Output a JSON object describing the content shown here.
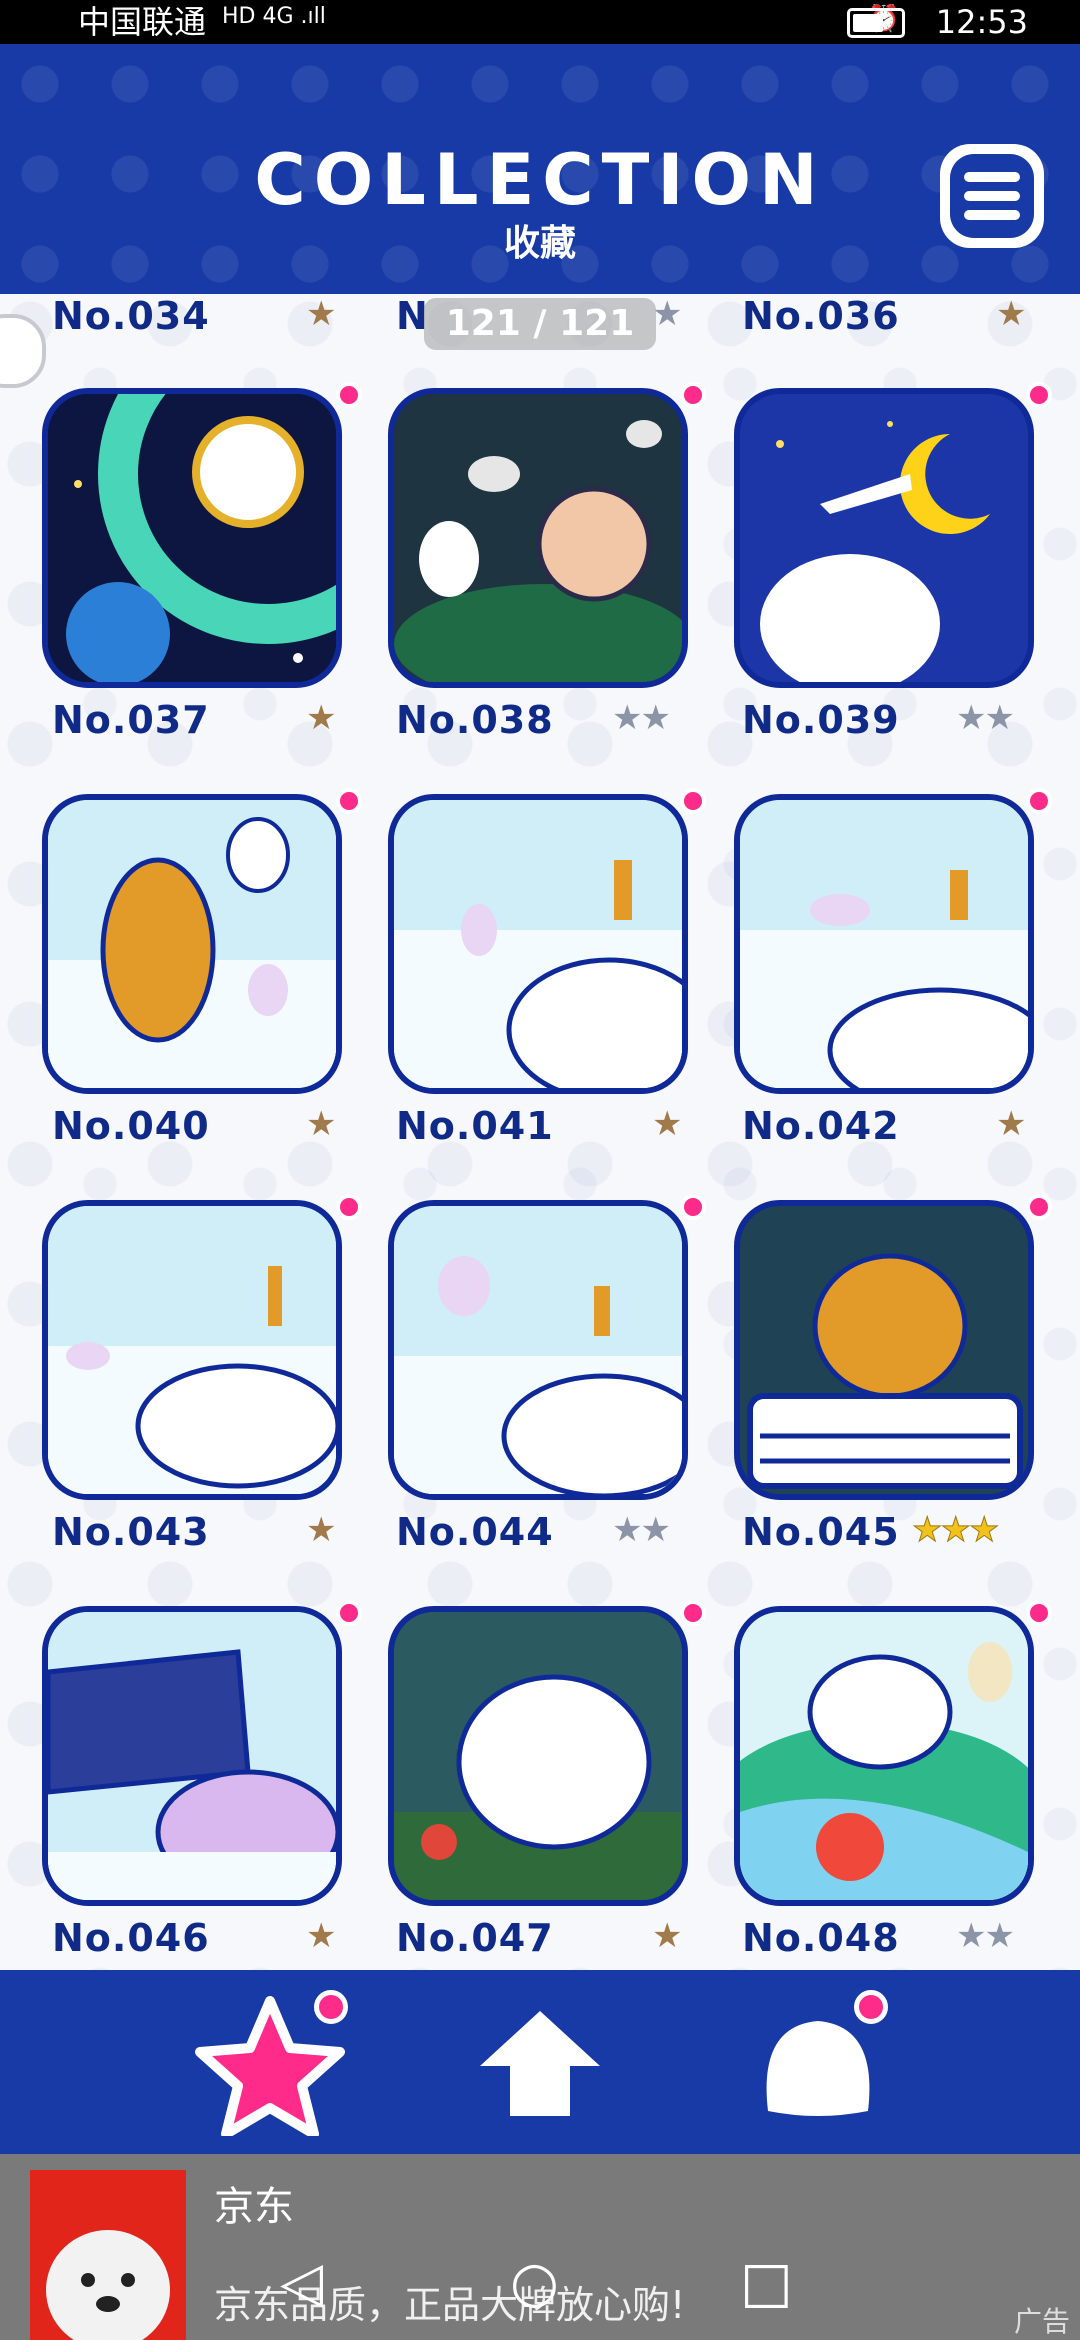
{
  "status_bar": {
    "carrier": "中国联通",
    "indicators": "HD 4G .ıll",
    "time": "12:53"
  },
  "header": {
    "title": "COLLECTION",
    "subtitle": "收藏",
    "menu_icon": "hamburger-menu-icon"
  },
  "counter": "121 / 121",
  "partial_row": [
    {
      "number": "No.034",
      "stars": 1,
      "star_color": "bronze"
    },
    {
      "number": "N",
      "stars": 1,
      "star_color": "grey"
    },
    {
      "number": "No.036",
      "stars": 1,
      "star_color": "bronze"
    }
  ],
  "items": [
    {
      "number": "No.037",
      "stars": "★",
      "star_color": "bronze",
      "scene": "space-dog-planet"
    },
    {
      "number": "No.038",
      "stars": "★★",
      "star_color": "grey",
      "scene": "night-bush-dog"
    },
    {
      "number": "No.039",
      "stars": "★★",
      "star_color": "grey",
      "scene": "moon-night-dog"
    },
    {
      "number": "No.040",
      "stars": "★",
      "star_color": "bronze",
      "scene": "bear-skating"
    },
    {
      "number": "No.041",
      "stars": "★",
      "star_color": "bronze",
      "scene": "ice-skater"
    },
    {
      "number": "No.042",
      "stars": "★",
      "star_color": "bronze",
      "scene": "skater-fall"
    },
    {
      "number": "No.043",
      "stars": "★",
      "star_color": "bronze",
      "scene": "skater-dog"
    },
    {
      "number": "No.044",
      "stars": "★★",
      "star_color": "grey",
      "scene": "skater-spin"
    },
    {
      "number": "No.045",
      "stars": "★★★",
      "star_color": "gold",
      "scene": "bear-car"
    },
    {
      "number": "No.046",
      "stars": "★",
      "star_color": "bronze",
      "scene": "bus-snow"
    },
    {
      "number": "No.047",
      "stars": "★",
      "star_color": "bronze",
      "scene": "dog-apple"
    },
    {
      "number": "No.048",
      "stars": "★★",
      "star_color": "grey",
      "scene": "river-apple"
    }
  ],
  "bottom_nav": [
    {
      "name": "collection-star-icon"
    },
    {
      "name": "home-house-icon"
    },
    {
      "name": "character-icon"
    }
  ],
  "ad": {
    "title": "京东",
    "description": "京东品质，正品大牌放心购!",
    "tag": "广告"
  },
  "colors": {
    "header_blue": "#173aa6",
    "label_navy": "#102a88",
    "badge_pink": "#ff2b8a"
  }
}
